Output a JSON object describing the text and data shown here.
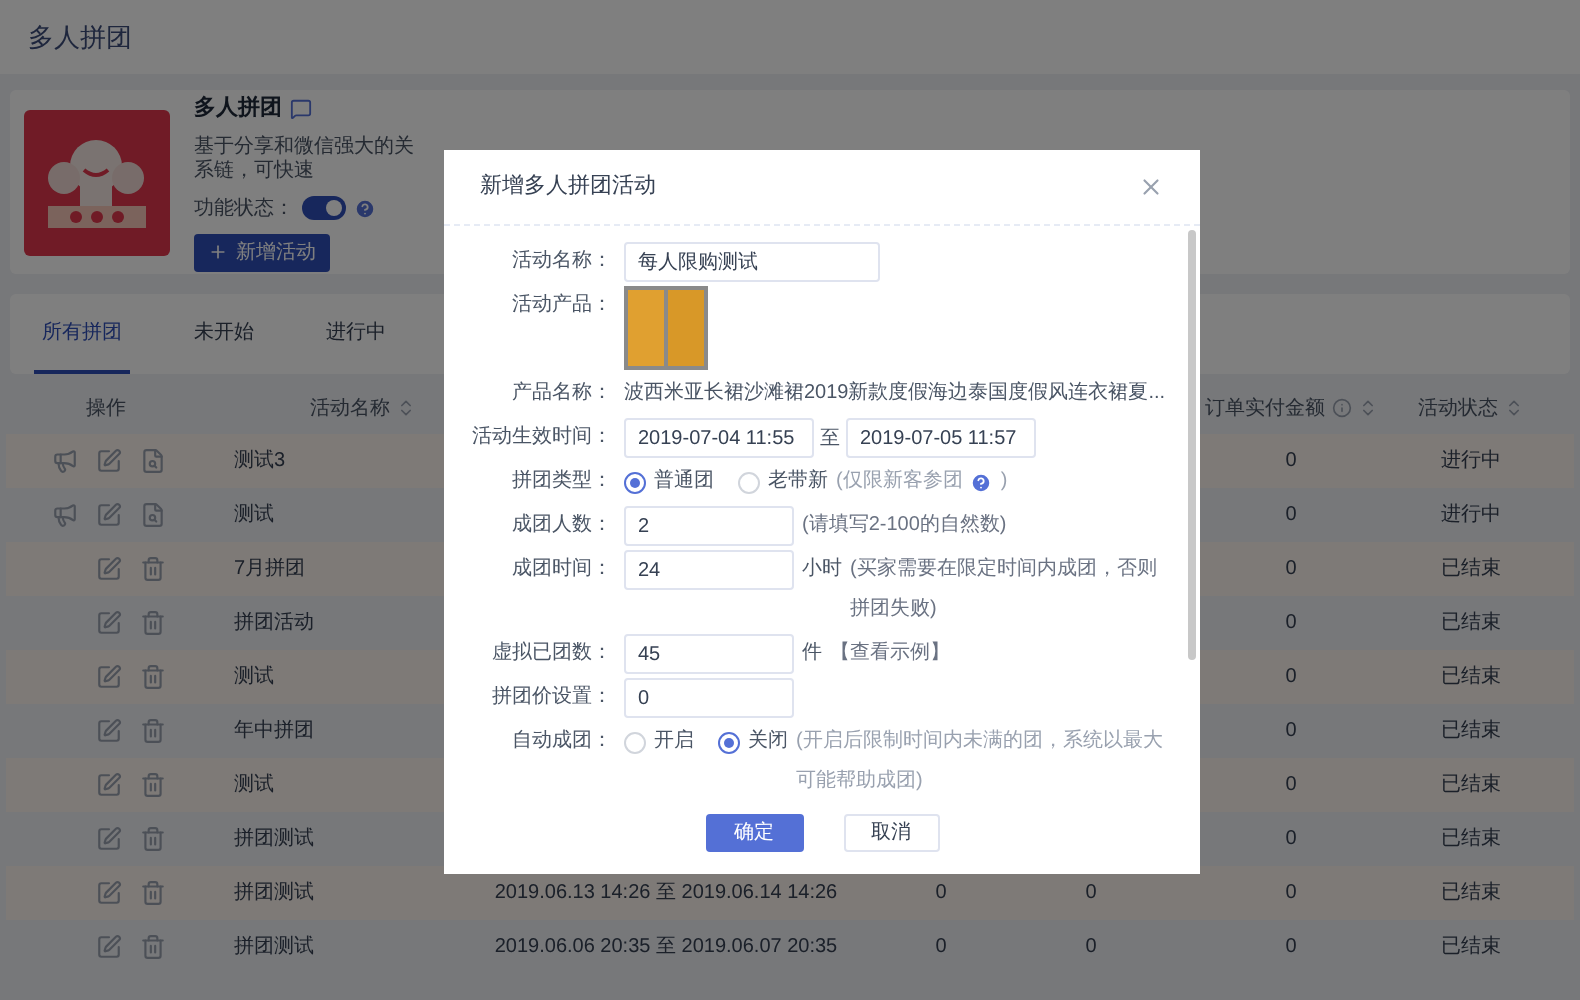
{
  "header": {
    "title": "多人拼团"
  },
  "feature_card": {
    "title": "多人拼团",
    "description": "基于分享和微信强大的关系链，可快速",
    "status_label": "功能状态：",
    "status_on": true,
    "add_button": "新增活动"
  },
  "tabs": [
    {
      "label": "所有拼团",
      "selected": true
    },
    {
      "label": "未开始",
      "selected": false
    },
    {
      "label": "进行中",
      "selected": false
    }
  ],
  "table": {
    "columns": [
      {
        "label": "操作",
        "sortable": false,
        "info": false
      },
      {
        "label": "活动名称",
        "sortable": true,
        "info": false
      },
      {
        "label": "订单实付金额",
        "sortable": true,
        "info": true
      },
      {
        "label": "活动状态",
        "sortable": true,
        "info": false
      }
    ],
    "rows": [
      {
        "actions": [
          {
            "kind": "promote"
          },
          {
            "kind": "edit"
          },
          {
            "kind": "stats"
          }
        ],
        "name": "测试3",
        "amount": "0",
        "status": "进行中"
      },
      {
        "actions": [
          {
            "kind": "promote"
          },
          {
            "kind": "edit"
          },
          {
            "kind": "stats"
          }
        ],
        "name": "测试",
        "amount": "0",
        "status": "进行中"
      },
      {
        "actions": [
          {
            "kind": "edit"
          },
          {
            "kind": "delete"
          }
        ],
        "name": "7月拼团",
        "amount": "0",
        "status": "已结束"
      },
      {
        "actions": [
          {
            "kind": "edit"
          },
          {
            "kind": "delete"
          }
        ],
        "name": "拼团活动",
        "amount": "0",
        "status": "已结束"
      },
      {
        "actions": [
          {
            "kind": "edit"
          },
          {
            "kind": "delete"
          }
        ],
        "name": "测试",
        "amount": "0",
        "status": "已结束"
      },
      {
        "actions": [
          {
            "kind": "edit"
          },
          {
            "kind": "delete"
          }
        ],
        "name": "年中拼团",
        "amount": "0",
        "status": "已结束"
      },
      {
        "actions": [
          {
            "kind": "edit"
          },
          {
            "kind": "delete"
          }
        ],
        "name": "测试",
        "amount": "0",
        "status": "已结束"
      },
      {
        "actions": [
          {
            "kind": "edit"
          },
          {
            "kind": "delete"
          }
        ],
        "name": "拼团测试",
        "amount": "0",
        "status": "已结束"
      },
      {
        "actions": [
          {
            "kind": "edit"
          },
          {
            "kind": "delete"
          }
        ],
        "name": "拼团测试",
        "period": "2019.06.13 14:26 至 2019.06.14 14:26",
        "column_3": "0",
        "column_4": "0",
        "amount": "0",
        "status": "已结束"
      },
      {
        "actions": [
          {
            "kind": "edit"
          },
          {
            "kind": "delete"
          }
        ],
        "name": "拼团测试",
        "period": "2019.06.06 20:35 至 2019.06.07 20:35",
        "column_3": "0",
        "column_4": "0",
        "amount": "0",
        "status": "已结束"
      }
    ]
  },
  "dialog": {
    "title": "新增多人拼团活动",
    "fields": [
      {
        "kind": "text_input",
        "label": "活动名称：",
        "value": "每人限购测试"
      },
      {
        "kind": "image",
        "label": "活动产品："
      },
      {
        "kind": "text",
        "label": "产品名称：",
        "value": "波西米亚长裙沙滩裙2019新款度假海边泰国度假风连衣裙夏..."
      },
      {
        "kind": "range",
        "label": "活动生效时间：",
        "start": "2019-07-04 11:55",
        "separator": "至",
        "end": "2019-07-05 11:57"
      },
      {
        "kind": "radio",
        "label": "拼团类型：",
        "options": [
          {
            "label": "普通团",
            "selected": true
          },
          {
            "label": "老带新",
            "selected": false,
            "note": "(仅限新客参团",
            "help": true,
            "note_end": ")"
          }
        ]
      },
      {
        "kind": "number_input",
        "label": "成团人数：",
        "value": "2",
        "hint": "(请填写2-100的自然数)"
      },
      {
        "kind": "number_input",
        "label": "成团时间：",
        "value": "24",
        "unit": "小时",
        "hint": "(买家需要在限定时间内成团，否则拼团失败)"
      },
      {
        "kind": "number_input",
        "label": "虚拟已团数：",
        "value": "45",
        "unit": "件",
        "link": "【查看示例】"
      },
      {
        "kind": "number_input",
        "label": "拼团价设置：",
        "value": "0"
      },
      {
        "kind": "radio",
        "label": "自动成团：",
        "options": [
          {
            "label": "开启",
            "selected": false
          },
          {
            "label": "关闭",
            "selected": true,
            "note": "(开启后限制时间内未满的团，系统以最大可能帮助成团)"
          }
        ]
      }
    ],
    "confirm": "确定",
    "cancel": "取消"
  }
}
